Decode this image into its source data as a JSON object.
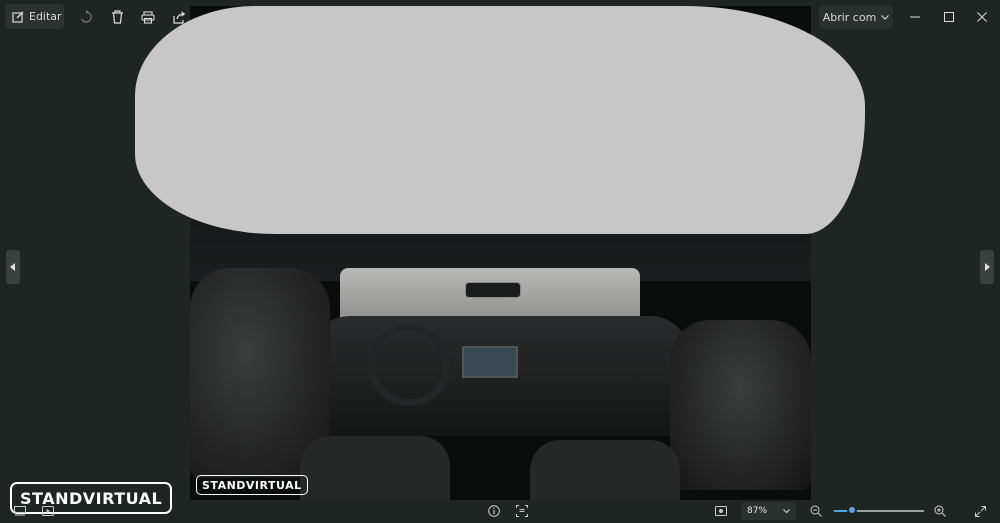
{
  "toolbar": {
    "edit_label": "Editar",
    "icons": [
      "edit-icon",
      "rotate-icon",
      "delete-icon",
      "print-icon",
      "share-icon",
      "more-icon"
    ]
  },
  "open_with": {
    "label": "Abrir com"
  },
  "window_controls": [
    "minimize-icon",
    "maximize-icon",
    "close-icon"
  ],
  "image": {
    "watermark_inner": "STANDVIRTUAL",
    "watermark_outer": "STANDVIRTUAL",
    "redacted": true
  },
  "bottom": {
    "zoom_label": "87%",
    "zoom_value": 0.2,
    "icons": [
      "filmstrip-icon",
      "slideshow-icon",
      "info-icon",
      "ocr-icon",
      "fit-icon",
      "zoom-out-icon",
      "zoom-in-icon",
      "fullscreen-icon"
    ]
  },
  "colors": {
    "background": "#1f2523",
    "accent": "#4ca6e8"
  }
}
